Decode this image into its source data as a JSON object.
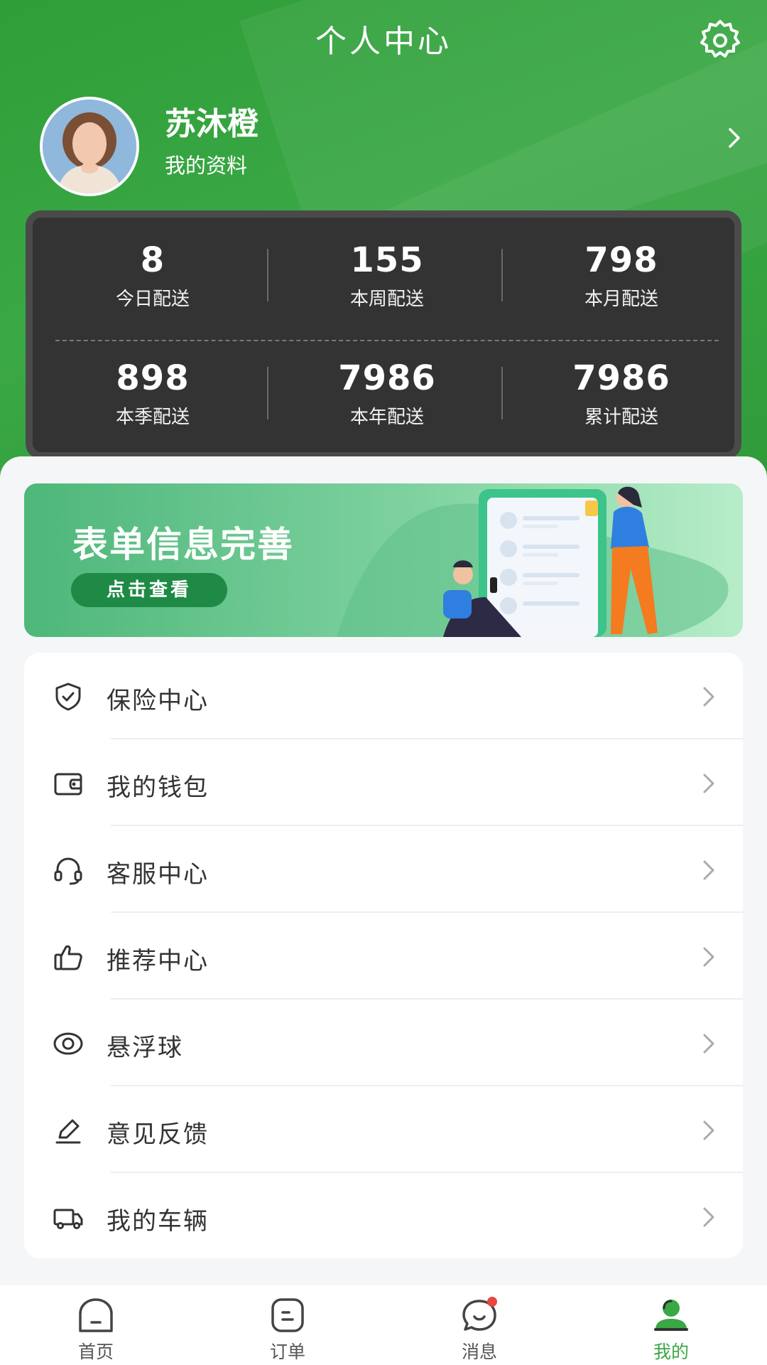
{
  "header": {
    "title": "个人中心",
    "settings_icon": "gear-icon"
  },
  "profile": {
    "name": "苏沐橙",
    "link_label": "我的资料"
  },
  "stats": [
    {
      "value": "8",
      "label": "今日配送"
    },
    {
      "value": "155",
      "label": "本周配送"
    },
    {
      "value": "798",
      "label": "本月配送"
    },
    {
      "value": "898",
      "label": "本季配送"
    },
    {
      "value": "7986",
      "label": "本年配送"
    },
    {
      "value": "7986",
      "label": "累计配送"
    }
  ],
  "banner": {
    "title": "表单信息完善",
    "button_label": "点击查看"
  },
  "menu": [
    {
      "label": "保险中心",
      "icon": "shield-check-icon"
    },
    {
      "label": "我的钱包",
      "icon": "wallet-icon"
    },
    {
      "label": "客服中心",
      "icon": "headset-icon"
    },
    {
      "label": "推荐中心",
      "icon": "thumbs-up-icon"
    },
    {
      "label": "悬浮球",
      "icon": "eye-icon"
    },
    {
      "label": "意见反馈",
      "icon": "pen-icon"
    },
    {
      "label": "我的车辆",
      "icon": "truck-icon"
    }
  ],
  "tabbar": [
    {
      "label": "首页",
      "icon": "home-icon"
    },
    {
      "label": "订单",
      "icon": "order-icon"
    },
    {
      "label": "消息",
      "icon": "message-icon"
    },
    {
      "label": "我的",
      "icon": "user-icon"
    }
  ],
  "tabbar_active": "我的",
  "colors": {
    "brand_green": "#3aa845",
    "stats_bg": "#333334",
    "badge_red": "#e8473d"
  }
}
